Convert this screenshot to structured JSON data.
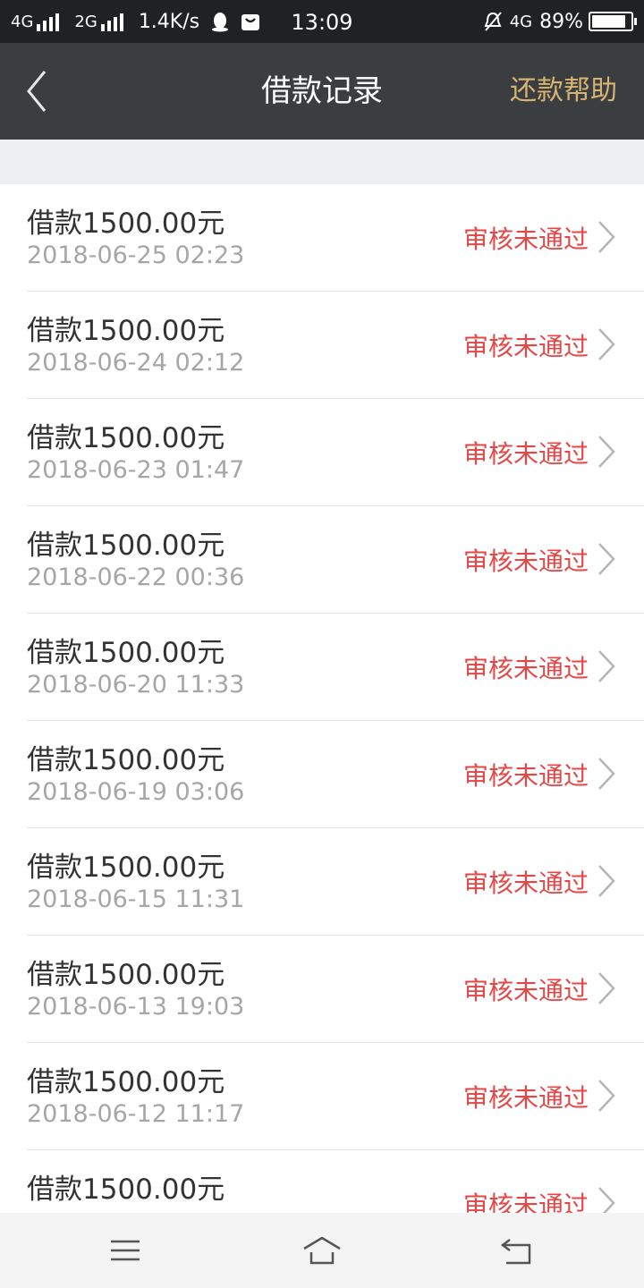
{
  "status_bar": {
    "network1": "4G",
    "network2": "2G",
    "speed": "1.4K/s",
    "time": "13:09",
    "network3": "4G",
    "battery": "89%"
  },
  "nav": {
    "title": "借款记录",
    "right_action": "还款帮助"
  },
  "colors": {
    "nav_bg": "#3b3e41",
    "accent_gold": "#d8b473",
    "status_red": "#e64646"
  },
  "records": [
    {
      "amount": "借款1500.00元",
      "date": "2018-06-25 02:23",
      "status": "审核未通过"
    },
    {
      "amount": "借款1500.00元",
      "date": "2018-06-24 02:12",
      "status": "审核未通过"
    },
    {
      "amount": "借款1500.00元",
      "date": "2018-06-23 01:47",
      "status": "审核未通过"
    },
    {
      "amount": "借款1500.00元",
      "date": "2018-06-22 00:36",
      "status": "审核未通过"
    },
    {
      "amount": "借款1500.00元",
      "date": "2018-06-20 11:33",
      "status": "审核未通过"
    },
    {
      "amount": "借款1500.00元",
      "date": "2018-06-19 03:06",
      "status": "审核未通过"
    },
    {
      "amount": "借款1500.00元",
      "date": "2018-06-15 11:31",
      "status": "审核未通过"
    },
    {
      "amount": "借款1500.00元",
      "date": "2018-06-13 19:03",
      "status": "审核未通过"
    },
    {
      "amount": "借款1500.00元",
      "date": "2018-06-12 11:17",
      "status": "审核未通过"
    },
    {
      "amount": "借款1500.00元",
      "date": "",
      "status": "审核未通过"
    }
  ],
  "icons": {
    "back": "back-chevron-icon",
    "row_chevron": "chevron-right-icon",
    "menu": "menu-icon",
    "home": "home-icon",
    "return": "return-icon"
  }
}
